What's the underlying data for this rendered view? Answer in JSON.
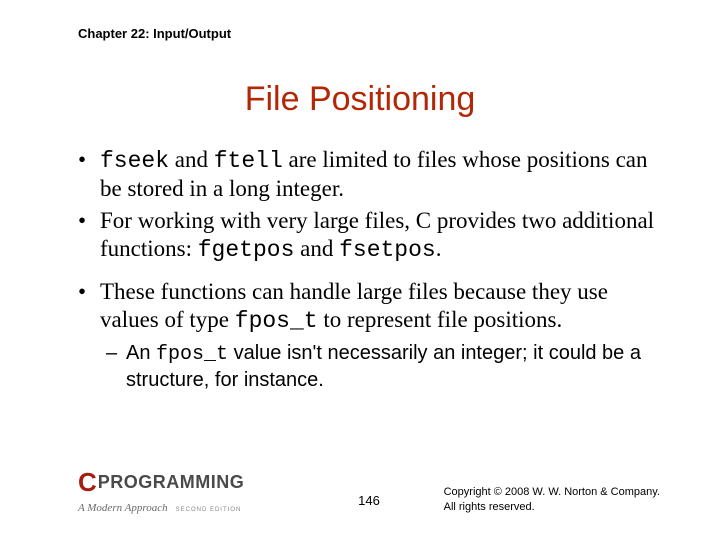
{
  "chapter_header": "Chapter 22: Input/Output",
  "title": "File Positioning",
  "bullets": [
    {
      "pre1": "fseek",
      "mid1": " and ",
      "pre2": "ftell",
      "rest": " are limited to files whose positions can be stored in a long integer."
    },
    {
      "text_a": "For working with very large files, C provides two additional functions: ",
      "code_a": "fgetpos",
      "text_b": " and ",
      "code_b": "fsetpos",
      "text_c": "."
    },
    {
      "text_a": "These functions can handle large files because they use values of type ",
      "code_a": "fpos_t",
      "text_b": " to represent file positions."
    }
  ],
  "sub_bullet": {
    "text_a": "An ",
    "code_a": "fpos_t",
    "text_b": " value isn't necessarily an integer; it could be a structure, for instance."
  },
  "footer": {
    "logo_c": "C",
    "logo_prog": "PROGRAMMING",
    "logo_sub": "A Modern Approach",
    "logo_ed": "SECOND EDITION",
    "page_num": "146",
    "copyright_line1": "Copyright © 2008 W. W. Norton & Company.",
    "copyright_line2": "All rights reserved."
  }
}
